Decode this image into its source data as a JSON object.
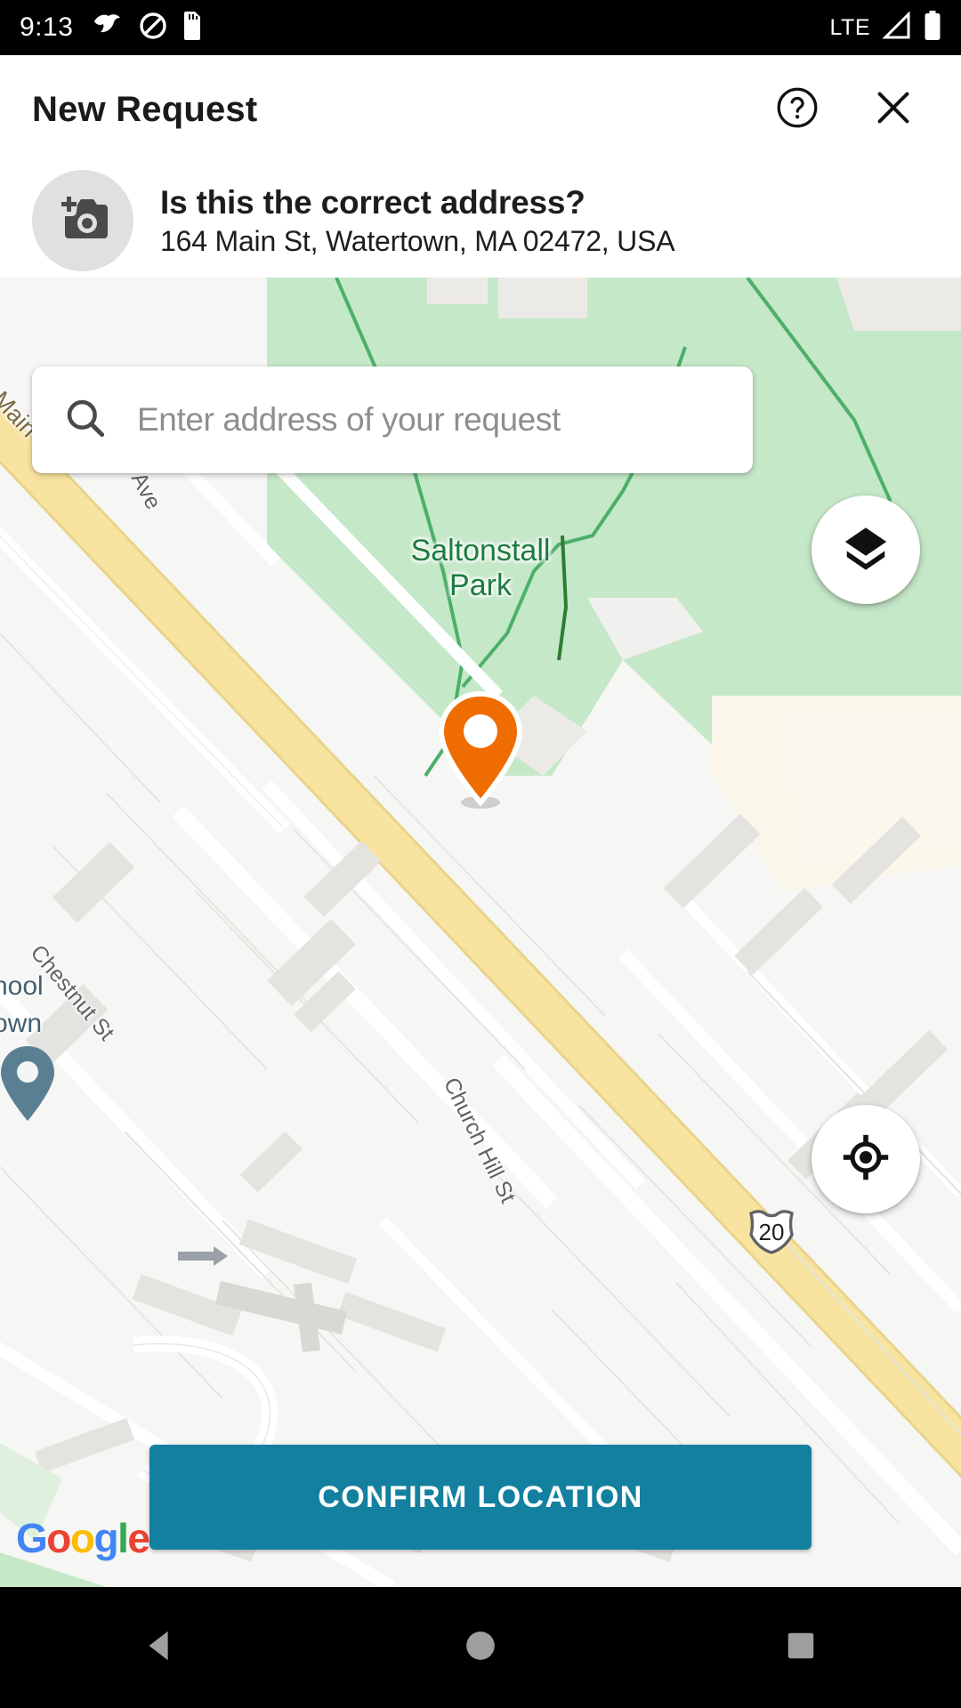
{
  "status_bar": {
    "clock": "9:13",
    "network_label": "LTE",
    "icons": [
      "bird-notification-icon",
      "do-not-disturb-icon",
      "sd-card-icon",
      "signal-icon",
      "battery-icon"
    ]
  },
  "header": {
    "title": "New Request",
    "help_icon": "help-circle-icon",
    "close_icon": "close-icon"
  },
  "address_prompt": {
    "avatar_icon": "add-photo-camera-icon",
    "question": "Is this the correct address?",
    "address": "164 Main St, Watertown, MA 02472, USA"
  },
  "search": {
    "placeholder": "Enter address of your request",
    "value": "",
    "icon": "search-icon"
  },
  "map": {
    "layers_icon": "layers-icon",
    "locate_icon": "my-location-icon",
    "marker_icon": "location-pin-marker",
    "poi_marker_icon": "poi-pin-marker",
    "attribution": "Google",
    "attribution_letters": [
      "G",
      "o",
      "o",
      "g",
      "l",
      "e"
    ],
    "route_shield": "20",
    "labels": [
      {
        "name": "Main St",
        "type": "road-major"
      },
      {
        "name": "Whites Ave",
        "type": "road"
      },
      {
        "name": "Saltonstall",
        "type": "park"
      },
      {
        "name": "Park",
        "type": "park"
      },
      {
        "name": "Chestnut St",
        "type": "road"
      },
      {
        "name": "Church Hill St",
        "type": "road"
      },
      {
        "name": "hool",
        "type": "poi"
      },
      {
        "name": "own",
        "type": "poi"
      }
    ],
    "colors": {
      "park_fill": "#c5e8c8",
      "road_major": "#f8e3a0",
      "land": "#f6f6f4",
      "building": "#eceae6",
      "marker": "#ef6c00",
      "poi_marker": "#5b7f92",
      "trail": "#4caf6a"
    }
  },
  "confirm": {
    "label": "CONFIRM LOCATION",
    "color": "#1380a0"
  },
  "nav_bar": {
    "back": "back-triangle-icon",
    "home": "home-circle-icon",
    "recents": "recents-square-icon"
  }
}
